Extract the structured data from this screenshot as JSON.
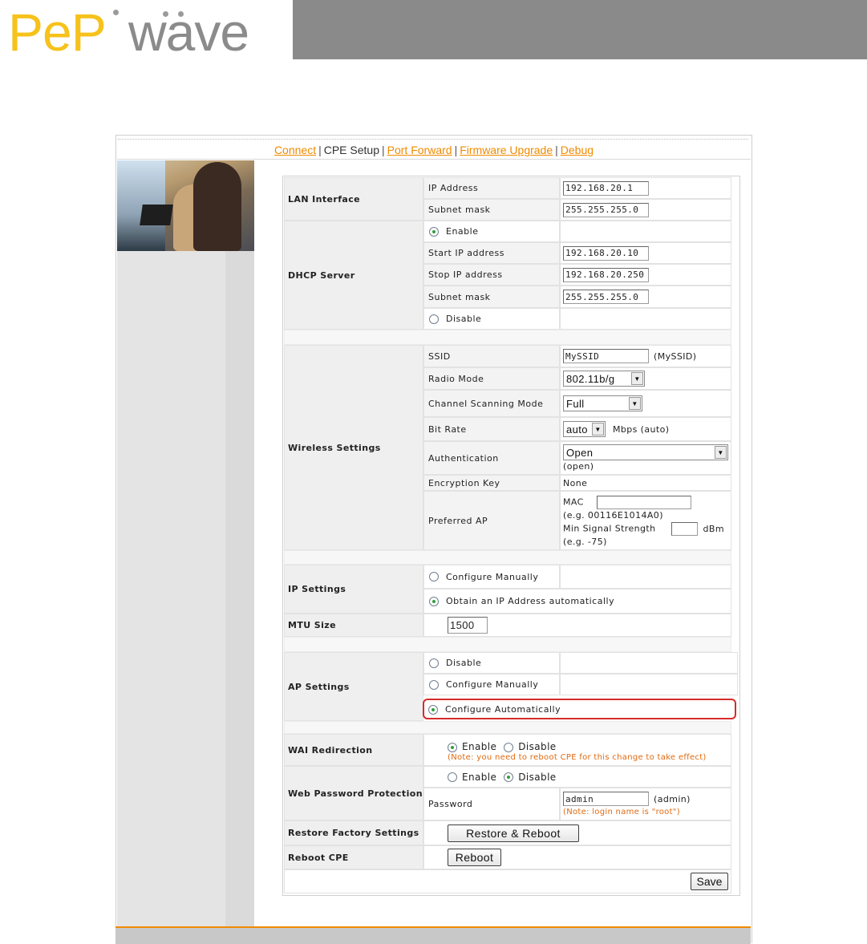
{
  "brand": {
    "logo_left": "PeP",
    "logo_right": "wave"
  },
  "nav": {
    "items": [
      {
        "label": "Connect",
        "link": true
      },
      {
        "label": "CPE Setup",
        "link": false
      },
      {
        "label": "Port Forward",
        "link": true
      },
      {
        "label": "Firmware Upgrade",
        "link": true
      },
      {
        "label": "Debug",
        "link": true
      }
    ],
    "separator": "|"
  },
  "lan": {
    "label": "LAN Interface",
    "ip_label": "IP Address",
    "ip_value": "192.168.20.1",
    "mask_label": "Subnet mask",
    "mask_value": "255.255.255.0"
  },
  "dhcp": {
    "label": "DHCP Server",
    "enable_label": "Enable",
    "enable_selected": true,
    "start_label": "Start IP address",
    "start_value": "192.168.20.10",
    "stop_label": "Stop IP address",
    "stop_value": "192.168.20.250",
    "mask_label": "Subnet mask",
    "mask_value": "255.255.255.0",
    "disable_label": "Disable"
  },
  "wireless": {
    "label": "Wireless Settings",
    "ssid_label": "SSID",
    "ssid_value": "MySSID",
    "ssid_hint": "(MySSID)",
    "radio_label": "Radio Mode",
    "radio_value": "802.11b/g",
    "scan_label": "Channel Scanning Mode",
    "scan_value": "Full",
    "bitrate_label": "Bit Rate",
    "bitrate_value": "auto",
    "bitrate_hint": "Mbps (auto)",
    "auth_label": "Authentication",
    "auth_value": "Open",
    "auth_hint": "(open)",
    "enc_label": "Encryption Key",
    "enc_value": "None",
    "pref_label": "Preferred AP",
    "mac_label": "MAC",
    "mac_value": "",
    "mac_hint": "(e.g. 00116E1014A0)",
    "signal_label": "Min Signal Strength",
    "signal_value": "",
    "signal_unit": "dBm",
    "signal_hint": "(e.g. -75)"
  },
  "ip_settings": {
    "label": "IP Settings",
    "manual_label": "Configure Manually",
    "auto_label": "Obtain an IP Address automatically",
    "auto_selected": true
  },
  "mtu": {
    "label": "MTU Size",
    "value": "1500"
  },
  "ap_settings": {
    "label": "AP Settings",
    "disable_label": "Disable",
    "manual_label": "Configure Manually",
    "auto_label": "Configure Automatically",
    "auto_selected": true
  },
  "wai": {
    "label": "WAI Redirection",
    "enable_label": "Enable",
    "enable_selected": true,
    "disable_label": "Disable",
    "note": "(Note: you need to reboot CPE for this change to take effect)"
  },
  "web_pw": {
    "label": "Web Password Protection",
    "enable_label": "Enable",
    "disable_label": "Disable",
    "disable_selected": true,
    "password_label": "Password",
    "password_value": "admin",
    "password_hint": "(admin)",
    "note": "(Note: login name is \"root\")"
  },
  "restore": {
    "label": "Restore Factory Settings",
    "button": "Restore & Reboot"
  },
  "reboot": {
    "label": "Reboot CPE",
    "button": "Reboot"
  },
  "save_button": "Save",
  "colors": {
    "brand_yellow": "#f6c21b",
    "brand_grey": "#8b8b8b",
    "link_orange": "#f08a00",
    "highlight_red": "#d62b2b",
    "radio_green": "#2f9e3a"
  }
}
